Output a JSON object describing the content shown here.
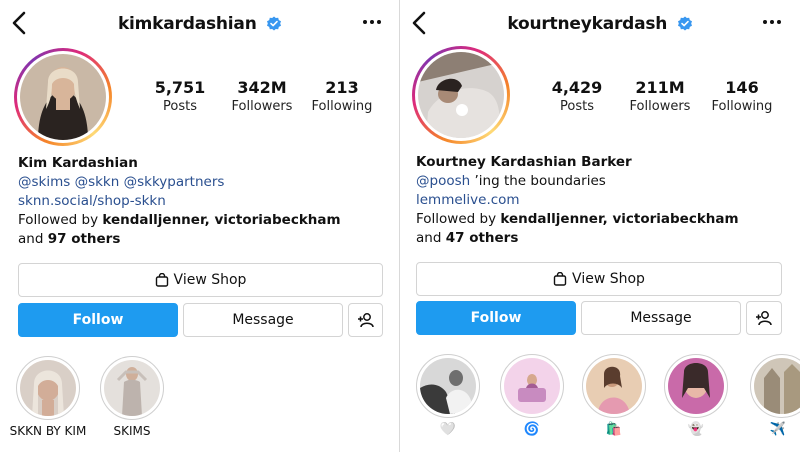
{
  "left": {
    "handle": "kimkardashian",
    "stats": [
      {
        "value": "5,751",
        "label": "Posts"
      },
      {
        "value": "342M",
        "label": "Followers"
      },
      {
        "value": "213",
        "label": "Following"
      }
    ],
    "bio": {
      "name": "Kim Kardashian",
      "mentions": "@skims @skkn @skkypartners",
      "link": "sknn.social/shop-skkn",
      "followed_prefix": "Followed by ",
      "followed_names": "kendalljenner, victoriabeckham",
      "others_prefix": "and ",
      "others": "97 others"
    },
    "buttons": {
      "shop": "View Shop",
      "follow": "Follow",
      "message": "Message"
    },
    "highlights": [
      {
        "label": "SKKN BY KIM"
      },
      {
        "label": "SKIMS"
      }
    ]
  },
  "right": {
    "handle": "kourtneykardash",
    "stats": [
      {
        "value": "4,429",
        "label": "Posts"
      },
      {
        "value": "211M",
        "label": "Followers"
      },
      {
        "value": "146",
        "label": "Following"
      }
    ],
    "bio": {
      "name": "Kourtney Kardashian Barker",
      "mention": "@poosh",
      "tagline": " ’ing the boundaries",
      "link": "lemmelive.com",
      "followed_prefix": "Followed by ",
      "followed_names": "kendalljenner, victoriabeckham",
      "others_prefix": "and ",
      "others": "47 others"
    },
    "buttons": {
      "shop": "View Shop",
      "follow": "Follow",
      "message": "Message"
    },
    "highlights": [
      {
        "label": "🤍"
      },
      {
        "label": "🌀"
      },
      {
        "label": "🛍️"
      },
      {
        "label": "👻"
      },
      {
        "label": "✈️"
      }
    ]
  },
  "colors": {
    "verified": "#3897f0",
    "follow": "#1e9bf0",
    "link": "#2a4f8f"
  },
  "icons": [
    "back-arrow-icon",
    "verified-badge-icon",
    "more-options-icon",
    "shop-bag-icon",
    "add-person-icon"
  ]
}
